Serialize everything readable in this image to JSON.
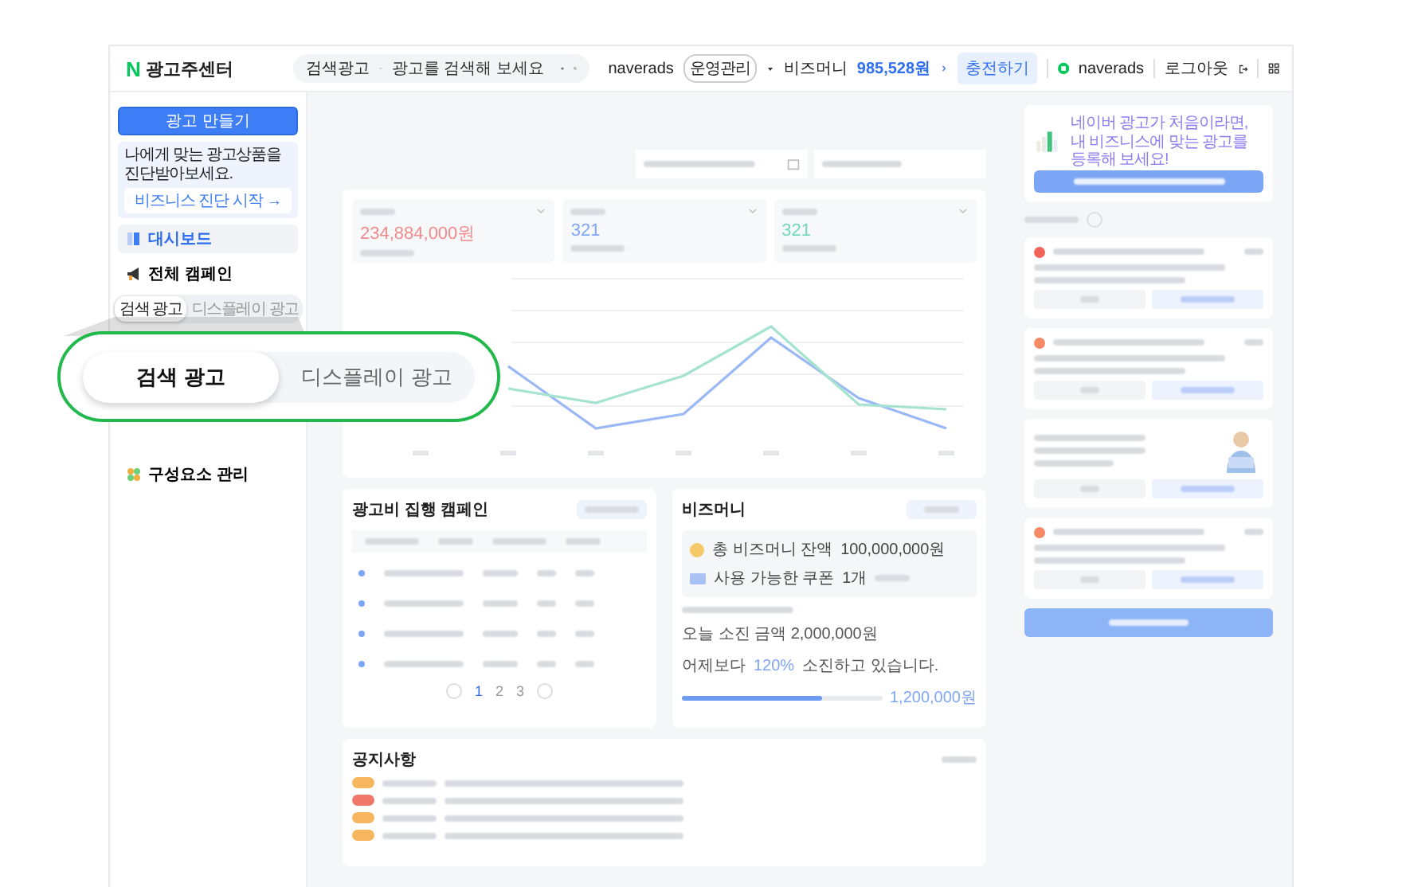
{
  "header": {
    "logo_mark": "N",
    "logo_text": "광고주센터",
    "search_scope": "검색광고",
    "search": {
      "placeholder": "광고를 검색해 보세요"
    },
    "account": "naverads",
    "account_role": "운영관리",
    "bizmoney_label": "비즈머니",
    "bizmoney_amount": "985,528원",
    "charge_button": "충전하기",
    "user": "naverads",
    "logout": "로그아웃"
  },
  "sidebar": {
    "create_button": "광고 만들기",
    "diagnosis": {
      "text": "나에게 맞는 광고상품을 진단받아보세요.",
      "button": "비즈니스 진단 시작 →"
    },
    "items": [
      {
        "label": "대시보드",
        "selected": true
      },
      {
        "label": "전체 캠페인",
        "selected": false
      }
    ],
    "ad_type_toggle": [
      {
        "label": "검색 광고",
        "selected": true
      },
      {
        "label": "디스플레이 광고",
        "selected": false
      }
    ],
    "bottom_items": [
      {
        "label": "구성요소 관리",
        "selected": false
      }
    ]
  },
  "callout": {
    "segments": [
      {
        "label": "검색 광고",
        "selected": true
      },
      {
        "label": "디스플레이 광고",
        "selected": false
      }
    ]
  },
  "dashboard": {
    "metrics": [
      {
        "value": "234,884,000원",
        "color": "#f08c8c"
      },
      {
        "value": "321",
        "color": "#7ea6f4"
      },
      {
        "value": "321",
        "color": "#72d6bb"
      }
    ],
    "campaign_card": {
      "title": "광고비 집행 캠페인",
      "pages": [
        {
          "label": "1",
          "selected": true
        },
        {
          "label": "2",
          "selected": false
        },
        {
          "label": "3",
          "selected": false
        }
      ]
    },
    "bizmoney": {
      "title": "비즈머니",
      "balance_label": "총 비즈머니 잔액",
      "balance": "100,000,000원",
      "coupon_label": "사용 가능한 쿠폰",
      "coupon_count": "1개",
      "today": "오늘 소진 금액 2,000,000원",
      "compare_prefix": "어제보다",
      "compare_rate": "120%",
      "compare_suffix": "소진하고 있습니다.",
      "compare_amount": "1,200,000원",
      "level": 0.7
    },
    "notices": {
      "title": "공지사항",
      "items": [
        {
          "color": "#f7b55e"
        },
        {
          "color": "#f0776a"
        },
        {
          "color": "#f7b55e"
        },
        {
          "color": "#f7b55e"
        }
      ]
    }
  },
  "right_panel": {
    "promo": "네이버 광고가 처음이라면, 내 비즈니스에 맞는 광고를 등록해 보세요!",
    "alerts": [
      {
        "kind": "notice",
        "color": "#f0645a"
      },
      {
        "kind": "notice",
        "color": "#f58a66"
      },
      {
        "kind": "consult"
      },
      {
        "kind": "notice",
        "color": "#f58a66"
      }
    ]
  }
}
